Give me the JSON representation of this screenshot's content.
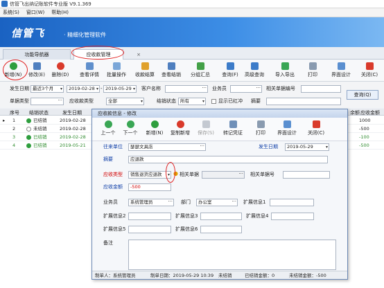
{
  "window": {
    "title": "信管飞出纳记账软件专业版 V9.1.369"
  },
  "menu": [
    "系统(S)",
    "窗口(W)",
    "帮助(H)"
  ],
  "banner": {
    "logo": "信管飞",
    "subtitle": "· 精细化管理软件"
  },
  "tabs": [
    {
      "label": "功能导航器"
    },
    {
      "label": "应收款管理"
    }
  ],
  "toolbar": [
    "新增(N)",
    "修改(E)",
    "删除(D)",
    "查看详情",
    "批量操作",
    "收款结算",
    "查看结销",
    "分组汇总",
    "查询(F)",
    "高级查询",
    "导入导出",
    "打印",
    "界面设计",
    "关闭(C)"
  ],
  "filter": {
    "date_label": "发生日期",
    "range": "最近3个月",
    "date_from": "2019-02-28",
    "to": "-",
    "date_to": "2019-05-29",
    "customer_label": "客户名称",
    "staff_label": "业务员",
    "related_no_label": "相关单据编号",
    "bill_type_label": "单据类型",
    "receivable_type_label": "应收款类型",
    "receivable_type_value": "全部",
    "settle_status_label": "结销状态",
    "settle_status_value": "所有",
    "show_red": "显示已红冲",
    "summary_label": "摘要",
    "query_button": "查询(Q)"
  },
  "grid": {
    "headers": [
      "序号",
      "结销状态",
      "发生日期",
      "余额",
      "应收金额"
    ],
    "rows": [
      {
        "no": "1",
        "status": "已结销",
        "date": "2019-02-28",
        "amount": "1000",
        "color": "#2e8b2e"
      },
      {
        "no": "2",
        "status": "未结销",
        "date": "2019-02-28",
        "amount": "-500",
        "color": "#222222"
      },
      {
        "no": "3",
        "status": "已结销",
        "date": "2019-02-28",
        "amount": "-100",
        "color": "#2e8b2e"
      },
      {
        "no": "4",
        "status": "已结销",
        "date": "2019-05-21",
        "amount": "-500",
        "color": "#2e8b2e"
      }
    ]
  },
  "dialog": {
    "title": "应收款信息 - 修改",
    "tools": [
      "上一个",
      "下一个",
      "新增(N)",
      "复制新增",
      "保存(S)",
      "转记凭证",
      "打印",
      "界面设计",
      "关闭(C)"
    ],
    "labels": {
      "partner": "往来单位",
      "date": "发生日期",
      "summary": "摘要",
      "type": "应收类型",
      "related": "相关单据",
      "related_no": "相关单据号",
      "amount": "应收金额",
      "staff": "业务员",
      "dept": "部门",
      "ext1": "扩展信息1",
      "ext2": "扩展信息2",
      "ext3": "扩展信息3",
      "ext4": "扩展信息4",
      "ext5": "扩展信息5",
      "ext6": "扩展信息6",
      "remark": "备注"
    },
    "values": {
      "partner": "瑟瑟文具店",
      "date": "2019-05-29",
      "summary": "应退款",
      "type": "销售退货应退款",
      "amount": "-500",
      "staff": "系统管理员",
      "dept": "办公室"
    },
    "status": {
      "maker": "制单人：系统管理员",
      "made_time": "制单日期：2019-05-29 10:39",
      "state": "未结销",
      "settled": "已结销金额：0",
      "unsettled": "未结销金额：-500"
    }
  }
}
